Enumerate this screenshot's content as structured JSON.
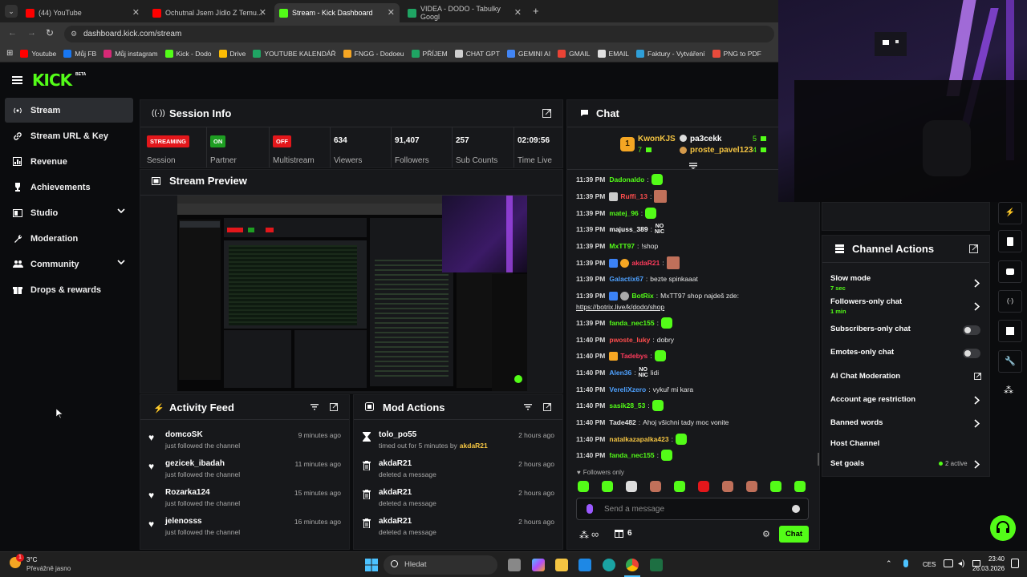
{
  "browser": {
    "tabs": [
      {
        "label": "(44) YouTube",
        "color": "#ff0000"
      },
      {
        "label": "Ochutnal Jsem Jídlo Z Temu... ",
        "color": "#ff0000"
      },
      {
        "label": "Stream - Kick Dashboard",
        "color": "#53fc18"
      },
      {
        "label": "VIDEA - DODO - Tabulky Googl",
        "color": "#1fa463"
      }
    ],
    "url": "dashboard.kick.com/stream",
    "bookmarks": [
      {
        "label": "Youtube",
        "color": "#ff0000"
      },
      {
        "label": "Můj FB",
        "color": "#1877f2"
      },
      {
        "label": "Můj instagram",
        "color": "#d62976"
      },
      {
        "label": "Kick - Dodo",
        "color": "#53fc18"
      },
      {
        "label": "Drive",
        "color": "#fbbc04"
      },
      {
        "label": "YOUTUBE KALENDÁŘ",
        "color": "#1fa463"
      },
      {
        "label": "FNGG - Dodoeu",
        "color": "#f5a623"
      },
      {
        "label": "PŘÍJEM",
        "color": "#1fa463"
      },
      {
        "label": "CHAT GPT",
        "color": "#cfcfcf"
      },
      {
        "label": "GEMINI AI",
        "color": "#4285f4"
      },
      {
        "label": "GMAIL",
        "color": "#ea4335"
      },
      {
        "label": "EMAIL",
        "color": "#e0e0e0"
      },
      {
        "label": "Faktury - Vytváření",
        "color": "#2f9fd8"
      },
      {
        "label": "PNG to PDF",
        "color": "#e94b3c"
      }
    ]
  },
  "brand": {
    "logo": "KICK",
    "beta": "BETA",
    "accent": "#53fc18"
  },
  "sidebar": {
    "items": [
      {
        "label": "Stream",
        "icon": "broadcast-icon"
      },
      {
        "label": "Stream URL & Key",
        "icon": "link-icon"
      },
      {
        "label": "Revenue",
        "icon": "chart-icon"
      },
      {
        "label": "Achievements",
        "icon": "trophy-icon"
      },
      {
        "label": "Studio",
        "icon": "studio-icon"
      },
      {
        "label": "Moderation",
        "icon": "wrench-icon"
      },
      {
        "label": "Community",
        "icon": "people-icon"
      },
      {
        "label": "Drops & rewards",
        "icon": "gift-icon"
      }
    ]
  },
  "session": {
    "title": "Session Info",
    "stats": [
      {
        "badge": "STREAMING",
        "badge_color": "#e3171b",
        "label": "Session"
      },
      {
        "badge": "ON",
        "badge_color": "#1e9e22",
        "label": "Partner"
      },
      {
        "badge": "OFF",
        "badge_color": "#e3171b",
        "label": "Multistream"
      },
      {
        "value": "634",
        "label": "Viewers"
      },
      {
        "value": "91,407",
        "label": "Followers"
      },
      {
        "value": "257",
        "label": "Sub Counts"
      },
      {
        "value": "02:09:56",
        "label": "Time Live"
      }
    ]
  },
  "preview": {
    "title": "Stream Preview"
  },
  "activity": {
    "title": "Activity Feed",
    "items": [
      {
        "name": "domcoSK",
        "desc": "just followed the channel",
        "time": "9 minutes ago"
      },
      {
        "name": "gezicek_ibadah",
        "desc": "just followed the channel",
        "time": "11 minutes ago"
      },
      {
        "name": "Rozarka124",
        "desc": "just followed the channel",
        "time": "15 minutes ago"
      },
      {
        "name": "jelenosss",
        "desc": "just followed the channel",
        "time": "16 minutes ago"
      }
    ]
  },
  "mod": {
    "title": "Mod Actions",
    "items": [
      {
        "name": "tolo_po55",
        "desc": "timed out for 5 minutes by",
        "by": "akdaR21",
        "time": "2 hours ago",
        "icon": "hourglass-icon"
      },
      {
        "name": "akdaR21",
        "desc": "deleted a message",
        "by": "",
        "time": "2 hours ago",
        "icon": "trash-icon"
      },
      {
        "name": "akdaR21",
        "desc": "deleted a message",
        "by": "",
        "time": "2 hours ago",
        "icon": "trash-icon"
      },
      {
        "name": "akdaR21",
        "desc": "deleted a message",
        "by": "",
        "time": "2 hours ago",
        "icon": "trash-icon"
      }
    ]
  },
  "chat": {
    "title": "Chat",
    "leaderboard": {
      "top": "KwonKJS",
      "top_count": "7",
      "rank": "1",
      "others": [
        {
          "name": "pa3cekk",
          "count": "5"
        },
        {
          "name": "proste_pavel123",
          "count": "4"
        }
      ]
    },
    "messages": [
      {
        "time": "11:39 PM",
        "user": "Dadonaldo",
        "color": "#53fc18",
        "text": "",
        "emote": "green"
      },
      {
        "time": "11:39 PM",
        "user": "Ruffi_13",
        "color": "#ff4d4d",
        "text": "",
        "emote": "face",
        "badge": "#ccc"
      },
      {
        "time": "11:39 PM",
        "user": "matej_96",
        "color": "#53fc18",
        "text": "",
        "emote": "green"
      },
      {
        "time": "11:39 PM",
        "user": "majuss_389",
        "color": "#ffffff",
        "text": "",
        "emote": "nonic"
      },
      {
        "time": "11:39 PM",
        "user": "MxTT97",
        "color": "#53fc18",
        "text": "!shop"
      },
      {
        "time": "11:39 PM",
        "user": "akdaR21",
        "color": "#ff3b5c",
        "text": "",
        "emote": "face",
        "badge": "#3b82f6",
        "badge2": "#f5a623"
      },
      {
        "time": "11:39 PM",
        "user": "Galactix67",
        "color": "#4ea1ff",
        "text": "bezte spinkaaat"
      },
      {
        "time": "11:39 PM",
        "user": "BotRix",
        "color": "#53fc18",
        "text": "MxTT97 shop najdeš zde:",
        "badge": "#3b82f6",
        "badge2": "#aaa"
      },
      {
        "time": "",
        "user": "",
        "color": "#fff",
        "text": "https://botrix.live/k/dodo/shop",
        "link": true
      },
      {
        "time": "11:39 PM",
        "user": "fanda_nec155",
        "color": "#53fc18",
        "text": "",
        "emote": "green"
      },
      {
        "time": "11:40 PM",
        "user": "pwoste_luky",
        "color": "#ff4d4d",
        "text": "dobry"
      },
      {
        "time": "11:40 PM",
        "user": "Tadebys",
        "color": "#ff3b5c",
        "text": "",
        "emote": "green",
        "badge": "#f5a623"
      },
      {
        "time": "11:40 PM",
        "user": "Alen36",
        "color": "#4ea1ff",
        "text": "lidi",
        "emote": "nonic"
      },
      {
        "time": "11:40 PM",
        "user": "VereliXzero",
        "color": "#4ea1ff",
        "text": "vykuř mi kara"
      },
      {
        "time": "11:40 PM",
        "user": "sasik28_53",
        "color": "#53fc18",
        "text": "",
        "emote": "green"
      },
      {
        "time": "11:40 PM",
        "user": "Tade482",
        "color": "#e0e0e0",
        "text": "Ahoj všichni tady moc vonite"
      },
      {
        "time": "11:40 PM",
        "user": "natalkazapalka423",
        "color": "#f5c542",
        "text": "",
        "emote": "green"
      },
      {
        "time": "11:40 PM",
        "user": "fanda_nec155",
        "color": "#53fc18",
        "text": "",
        "emote": "green"
      }
    ],
    "followers_only": "Followers only",
    "placeholder": "Send a message",
    "points": "∞",
    "gifts": "6",
    "send_label": "Chat"
  },
  "channel_actions": {
    "title": "Channel Actions",
    "items": [
      {
        "label": "Slow mode",
        "sub": "7 sec",
        "control": "chevron"
      },
      {
        "label": "Followers-only chat",
        "sub": "1 min",
        "control": "chevron"
      },
      {
        "label": "Subscribers-only chat",
        "sub": "",
        "control": "toggle"
      },
      {
        "label": "Emotes-only chat",
        "sub": "",
        "control": "toggle"
      },
      {
        "label": "AI Chat Moderation",
        "sub": "",
        "control": "external"
      },
      {
        "label": "Account age restriction",
        "sub": "",
        "control": "chevron"
      },
      {
        "label": "Banned words",
        "sub": "",
        "control": "chevron"
      },
      {
        "label": "Host Channel",
        "sub": "",
        "control": "none"
      },
      {
        "label": "Set goals",
        "sub": "",
        "control": "chevron",
        "status": "2 active"
      }
    ]
  },
  "taskbar": {
    "temp": "3°C",
    "weather": "Převážně jasno",
    "search": "Hledat",
    "lang": "CES",
    "time": "23:40",
    "date": "26.03.2026",
    "notif": "1"
  }
}
